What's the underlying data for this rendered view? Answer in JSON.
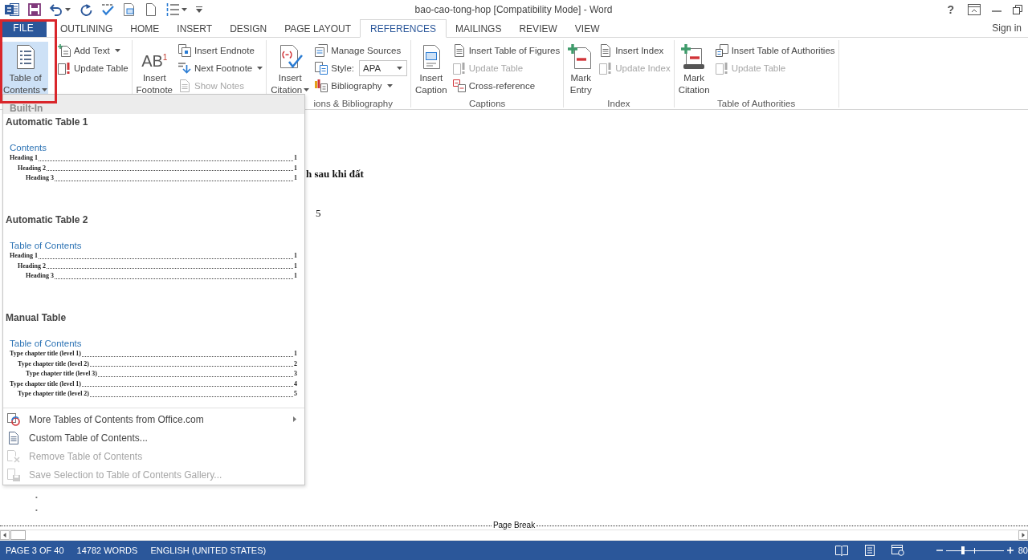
{
  "window": {
    "title": "bao-cao-tong-hop [Compatibility Mode] - Word",
    "help": "?"
  },
  "tabs": [
    {
      "label": "FILE",
      "kind": "file",
      "selected": false
    },
    {
      "label": "OUTLINING",
      "kind": "tab",
      "selected": false
    },
    {
      "label": "HOME",
      "kind": "tab",
      "selected": false
    },
    {
      "label": "INSERT",
      "kind": "tab",
      "selected": false
    },
    {
      "label": "DESIGN",
      "kind": "tab",
      "selected": false
    },
    {
      "label": "PAGE LAYOUT",
      "kind": "tab",
      "selected": false
    },
    {
      "label": "REFERENCES",
      "kind": "tab",
      "selected": true
    },
    {
      "label": "MAILINGS",
      "kind": "tab",
      "selected": false
    },
    {
      "label": "REVIEW",
      "kind": "tab",
      "selected": false
    },
    {
      "label": "VIEW",
      "kind": "tab",
      "selected": false
    }
  ],
  "account": {
    "label": "Sign in"
  },
  "ribbon": {
    "groups": [
      {
        "large": {
          "label": "Table of Contents",
          "dropdown": true,
          "pressed": true
        },
        "small": [
          {
            "kind": "button",
            "label": "Add Text",
            "dropdown": true,
            "disabled": false
          },
          {
            "kind": "button",
            "label": "Update Table",
            "dropdown": false,
            "disabled": false
          }
        ]
      },
      {
        "large": {
          "label": "Insert Footnote",
          "glyph": "AB$^{1}$",
          "dropdown": false,
          "pressed": false
        },
        "small": [
          {
            "kind": "button",
            "label": "Insert Endnote",
            "dropdown": false,
            "disabled": false
          },
          {
            "kind": "button",
            "label": "Next Footnote",
            "dropdown": true,
            "disabled": false
          },
          {
            "kind": "button",
            "label": "Show Notes",
            "dropdown": false,
            "disabled": true
          }
        ]
      },
      {
        "label": "ions & Bibliography",
        "large": {
          "label": "Insert Citation",
          "dropdown": true,
          "pressed": false
        },
        "small": [
          {
            "kind": "button",
            "label": "Manage Sources",
            "dropdown": false,
            "disabled": false
          },
          {
            "kind": "select",
            "label": "Style:",
            "value": "APA",
            "disabled": false
          },
          {
            "kind": "button",
            "label": "Bibliography",
            "dropdown": true,
            "disabled": false
          }
        ]
      },
      {
        "label": "Captions",
        "large": {
          "label": "Insert Caption",
          "dropdown": false,
          "pressed": false
        },
        "small": [
          {
            "kind": "button",
            "label": "Insert Table of Figures",
            "dropdown": false,
            "disabled": false
          },
          {
            "kind": "button",
            "label": "Update Table",
            "dropdown": false,
            "disabled": true
          },
          {
            "kind": "button",
            "label": "Cross-reference",
            "dropdown": false,
            "disabled": false
          }
        ]
      },
      {
        "label": "Index",
        "large": {
          "label": "Mark Entry",
          "dropdown": false,
          "pressed": false
        },
        "small": [
          {
            "kind": "button",
            "label": "Insert Index",
            "dropdown": false,
            "disabled": false
          },
          {
            "kind": "button",
            "label": "Update Index",
            "dropdown": false,
            "disabled": true
          }
        ]
      },
      {
        "label": "Table of Authorities",
        "large": {
          "label": "Mark Citation",
          "dropdown": false,
          "pressed": false
        },
        "small": [
          {
            "kind": "button",
            "label": "Insert Table of Authorities",
            "dropdown": false,
            "disabled": false
          },
          {
            "kind": "button",
            "label": "Update Table",
            "dropdown": false,
            "disabled": true
          }
        ]
      }
    ]
  },
  "toc_menu": {
    "header": "Built-In",
    "gallery": [
      {
        "title": "Automatic Table 1",
        "preview": {
          "heading": "Contents",
          "entries": [
            {
              "text": "Heading 1",
              "page": "1",
              "children": [
                {
                  "text": "Heading 2",
                  "page": "1",
                  "children": [
                    {
                      "text": "Heading 3",
                      "page": "1"
                    }
                  ]
                }
              ]
            }
          ]
        }
      },
      {
        "title": "Automatic Table 2",
        "preview": {
          "heading": "Table of Contents",
          "entries": [
            {
              "text": "Heading 1",
              "page": "1",
              "children": [
                {
                  "text": "Heading 2",
                  "page": "1",
                  "children": [
                    {
                      "text": "Heading 3",
                      "page": "1"
                    }
                  ]
                }
              ]
            }
          ]
        }
      },
      {
        "title": "Manual Table",
        "preview": {
          "heading": "Table of Contents",
          "entries": [
            {
              "text": "Type chapter title (level 1)",
              "page": "1",
              "children": [
                {
                  "text": "Type chapter title (level 2)",
                  "page": "2",
                  "children": [
                    {
                      "text": "Type chapter title (level 3)",
                      "page": "3"
                    }
                  ]
                }
              ]
            },
            {
              "text": "Type chapter title (level 1)",
              "page": "4",
              "children": [
                {
                  "text": "Type chapter title (level 2)",
                  "page": "5"
                }
              ]
            }
          ]
        }
      }
    ],
    "commands": [
      {
        "label": "More Tables of Contents from Office.com",
        "submenu": true,
        "disabled": false
      },
      {
        "label": "Custom Table of Contents...",
        "submenu": false,
        "disabled": false
      },
      {
        "label": "Remove Table of Contents",
        "submenu": false,
        "disabled": true
      },
      {
        "label": "Save Selection to Table of Contents Gallery...",
        "submenu": false,
        "disabled": true
      }
    ]
  },
  "document": {
    "paragraphs": [
      {
        "text": "h sau khi đất",
        "bold": true
      },
      {
        "text": "5",
        "bold": false
      }
    ],
    "list_marks": [
      "•",
      "•"
    ],
    "page_break": "Page Break"
  },
  "status_bar": {
    "page": "PAGE 3 OF 40",
    "words": "14782 WORDS",
    "language": "ENGLISH (UNITED STATES)",
    "zoom": {
      "level": 0.3,
      "reading": "80"
    }
  },
  "annotations": [
    {
      "kind": "frame"
    }
  ]
}
